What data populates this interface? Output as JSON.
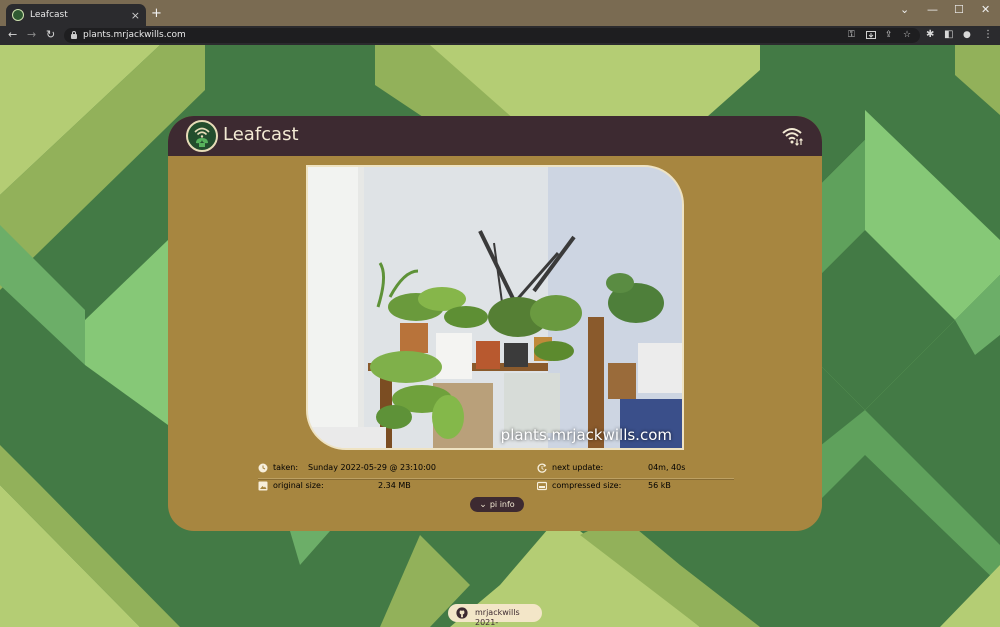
{
  "browser": {
    "tab_title": "Leafcast",
    "tab_close": "×",
    "new_tab": "+",
    "url": "plants.mrjackwills.com",
    "window_controls": {
      "chevron": "⌄",
      "minimize": "—",
      "maximize": "☐",
      "close": "✕"
    },
    "nav": {
      "back": "←",
      "forward": "→",
      "reload": "↻"
    },
    "omnibox_icons": {
      "key": "⚿",
      "share": "⇪",
      "star": "☆"
    },
    "toolbar_icons": {
      "extensions": "✱",
      "sidebar": "◧",
      "profile": "●",
      "menu": "⋮"
    }
  },
  "header": {
    "brand": "Leafcast"
  },
  "photo": {
    "watermark": "plants.mrjackwills.com"
  },
  "info": {
    "taken_label": "taken:",
    "taken_value": "Sunday 2022-05-29 @ 23:10:00",
    "next_label": "next update:",
    "next_value": "04m, 40s",
    "original_label": "original size:",
    "original_value": "2.34 MB",
    "compressed_label": "compressed size:",
    "compressed_value": "56 kB"
  },
  "pi_button": {
    "chevron": "⌄",
    "label": "pi info"
  },
  "footer": {
    "text": "mrjackwills 2021-"
  },
  "colors": {
    "background_dark": "#437a45",
    "background_light": "#b4cd74",
    "card": "#a78640",
    "header": "#3d2a31",
    "cream": "#f3ead4"
  }
}
